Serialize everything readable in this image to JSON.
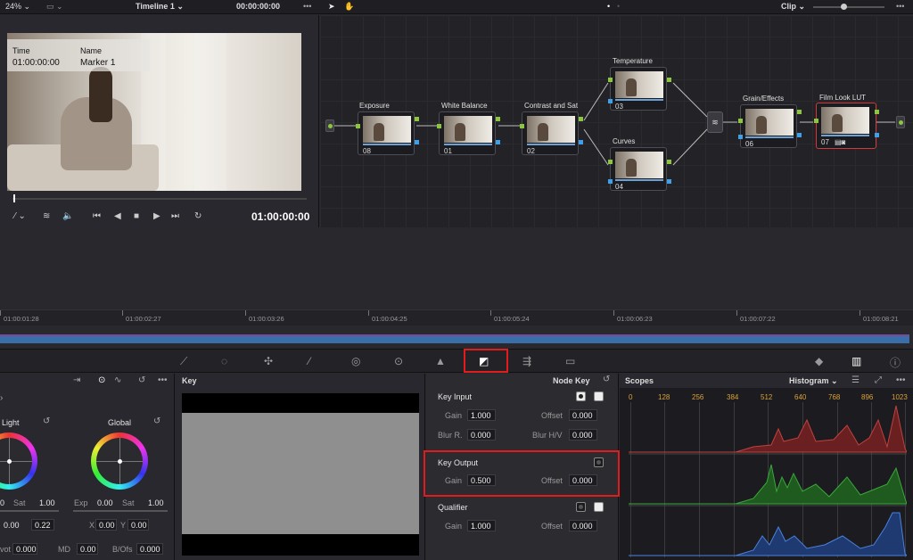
{
  "topbar": {
    "zoom": "24%",
    "timeline": "Timeline 1",
    "timecode": "00:00:00:00",
    "clip_mode": "Clip"
  },
  "viewer": {
    "overlay": {
      "time_label": "Time",
      "name_label": "Name",
      "time_value": "01:00:00:00",
      "name_value": "Marker 1"
    },
    "timecode": "01:00:00:00"
  },
  "nodes": [
    {
      "label": "Exposure",
      "num": "08"
    },
    {
      "label": "White Balance",
      "num": "01"
    },
    {
      "label": "Contrast and Sat",
      "num": "02"
    },
    {
      "label": "Temperature",
      "num": "03"
    },
    {
      "label": "Curves",
      "num": "04"
    },
    {
      "label": "Grain/Effects",
      "num": "06"
    },
    {
      "label": "Film Look LUT",
      "num": "07"
    }
  ],
  "timeline": {
    "ticks": [
      "01:00:01:28",
      "01:00:02:27",
      "01:00:03:26",
      "01:00:04:25",
      "01:00:05:24",
      "01:00:06:23",
      "01:00:07:22",
      "01:00:08:21"
    ]
  },
  "wheels": {
    "light_label": "Light",
    "global_label": "Global",
    "sat_label": "Sat",
    "sat_light": "1.00",
    "sat_global": "1.00",
    "exp_label": "Exp",
    "exp_value": "0.00",
    "left_val_1": "0",
    "left_val_2": "0.00",
    "mid_val": "0.22",
    "x_label": "X",
    "x_value": "0.00",
    "y_label": "Y",
    "y_value": "0.00",
    "pivot_label": "vot",
    "pivot_value": "0.000",
    "md_label": "MD",
    "md_value": "0.00",
    "bofs_label": "B/Ofs",
    "bofs_value": "0.000"
  },
  "key_panel": {
    "title": "Key",
    "mode": "Node Key"
  },
  "key_input": {
    "title": "Key Input",
    "gain_label": "Gain",
    "gain": "1.000",
    "offset_label": "Offset",
    "offset": "0.000",
    "blur_r_label": "Blur R.",
    "blur_r": "0.000",
    "blur_hv_label": "Blur H/V",
    "blur_hv": "0.000"
  },
  "key_output": {
    "title": "Key Output",
    "gain_label": "Gain",
    "gain": "0.500",
    "offset_label": "Offset",
    "offset": "0.000"
  },
  "qualifier": {
    "title": "Qualifier",
    "gain_label": "Gain",
    "gain": "1.000",
    "offset_label": "Offset",
    "offset": "0.000"
  },
  "scopes": {
    "title": "Scopes",
    "mode": "Histogram",
    "scale": [
      "0",
      "128",
      "256",
      "384",
      "512",
      "640",
      "768",
      "896",
      "1023"
    ],
    "colors": {
      "red": "#b03030",
      "green": "#2f9a2f",
      "blue": "#3a6ed0"
    }
  },
  "accent": {
    "highlight": "#e01c1c",
    "selected_node": "#d03a3a",
    "port_green": "#8cc63f",
    "port_blue": "#3ea0e8"
  }
}
